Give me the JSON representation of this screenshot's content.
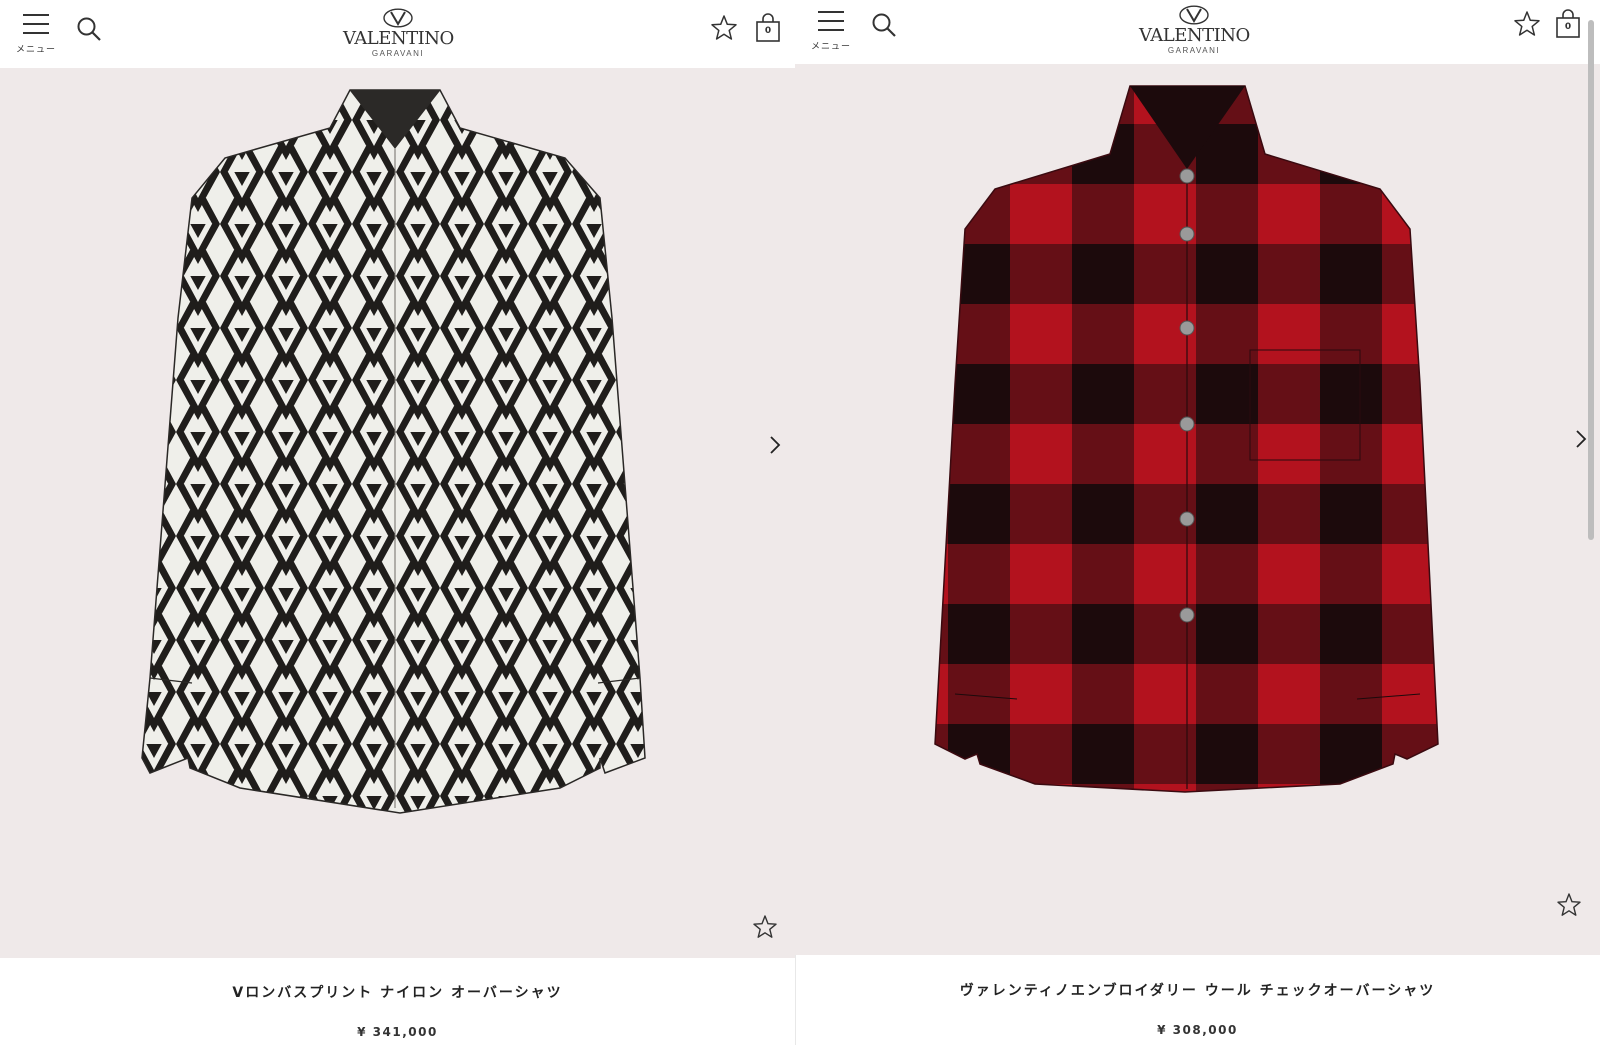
{
  "header": {
    "menu_label": "メニュー",
    "brand": "VALENTINO",
    "brand_sub": "GARAVANI",
    "bag_count": "0"
  },
  "products": [
    {
      "name": "Vロンバスプリント ナイロン オーバーシャツ",
      "price": "¥ 341,000",
      "pattern": "black-white V chevron print"
    },
    {
      "name": "ヴァレンティノエンブロイダリー ウール チェックオーバーシャツ",
      "price": "¥ 308,000",
      "pattern": "red-black buffalo check"
    }
  ],
  "icons": {
    "menu": "hamburger-icon",
    "search": "search-icon",
    "wishlist": "star-icon",
    "bag": "shopping-bag-icon",
    "next": "chevron-right-icon"
  },
  "colors": {
    "product_bg": "#efe9e9",
    "text": "#222222",
    "check_red": "#b3121e",
    "check_dark": "#1c0a0c"
  }
}
